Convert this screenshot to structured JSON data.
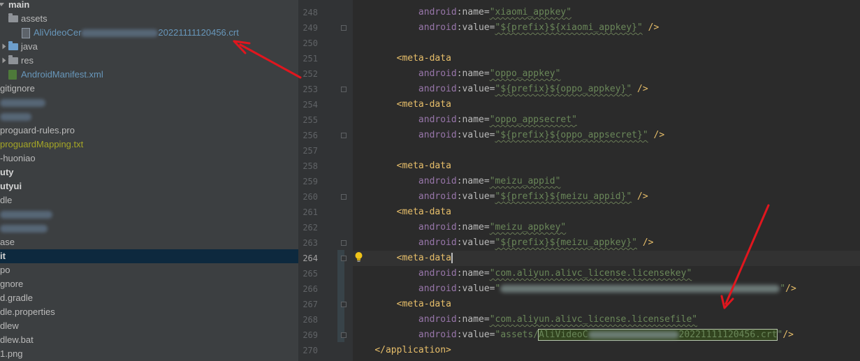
{
  "project_tree": {
    "items": [
      {
        "label": "main",
        "style": "bold"
      },
      {
        "label": "assets",
        "style": "normal"
      },
      {
        "label_prefix": "AliVideoCer",
        "label_suffix": "20221111120456.crt",
        "style": "blue"
      },
      {
        "label": "java",
        "style": "normal"
      },
      {
        "label": "res",
        "style": "normal"
      },
      {
        "label": "AndroidManifest.xml",
        "style": "blue"
      },
      {
        "label": "gitignore",
        "style": "normal"
      },
      {
        "label": "",
        "style": "blurred"
      },
      {
        "label": "",
        "style": "blurred"
      },
      {
        "label": "proguard-rules.pro",
        "style": "normal"
      },
      {
        "label": "proguardMapping.txt",
        "style": "olive"
      },
      {
        "label": "-huoniao",
        "style": "normal"
      },
      {
        "label": "uty",
        "style": "bold"
      },
      {
        "label": "utyui",
        "style": "bold"
      },
      {
        "label": "dle",
        "style": "normal"
      },
      {
        "label": "",
        "style": "blurred"
      },
      {
        "label": "",
        "style": "blurred"
      },
      {
        "label": "ase",
        "style": "normal"
      },
      {
        "label": "it",
        "style": "bold-selected"
      },
      {
        "label": "po",
        "style": "normal"
      },
      {
        "label": "gnore",
        "style": "normal"
      },
      {
        "label": "d.gradle",
        "style": "normal"
      },
      {
        "label": "dle.properties",
        "style": "normal"
      },
      {
        "label": "dlew",
        "style": "normal"
      },
      {
        "label": "dlew.bat",
        "style": "normal"
      },
      {
        "label": "1.png",
        "style": "normal"
      }
    ]
  },
  "editor": {
    "current_line": 264,
    "lines": [
      {
        "n": "248",
        "attr": "name",
        "val": "xiaomi_appkey",
        "end": ""
      },
      {
        "n": "249",
        "attr": "value",
        "val": "${prefix}${xiaomi_appkey}",
        "end": " />"
      },
      {
        "n": "250"
      },
      {
        "n": "251",
        "open": "meta-data"
      },
      {
        "n": "252",
        "attr": "name",
        "val": "oppo_appkey",
        "end": ""
      },
      {
        "n": "253",
        "attr": "value",
        "val": "${prefix}${oppo_appkey}",
        "end": " />"
      },
      {
        "n": "254",
        "open": "meta-data"
      },
      {
        "n": "255",
        "attr": "name",
        "val": "oppo_appsecret",
        "end": ""
      },
      {
        "n": "256",
        "attr": "value",
        "val": "${prefix}${oppo_appsecret}",
        "end": " />"
      },
      {
        "n": "257"
      },
      {
        "n": "258",
        "open": "meta-data"
      },
      {
        "n": "259",
        "attr": "name",
        "val": "meizu_appid",
        "end": ""
      },
      {
        "n": "260",
        "attr": "value",
        "val": "${prefix}${meizu_appid}",
        "end": " />"
      },
      {
        "n": "261",
        "open": "meta-data"
      },
      {
        "n": "262",
        "attr": "name",
        "val": "meizu_appkey",
        "end": ""
      },
      {
        "n": "263",
        "attr": "value",
        "val": "${prefix}${meizu_appkey}",
        "end": " />"
      },
      {
        "n": "264",
        "open": "meta-data",
        "caret": true
      },
      {
        "n": "265",
        "attr": "name",
        "val": "com.aliyun.alivc_license.licensekey",
        "end": ""
      },
      {
        "n": "266",
        "attr": "value",
        "val_blurred": true,
        "end": "/>"
      },
      {
        "n": "267",
        "open": "meta-data"
      },
      {
        "n": "268",
        "attr": "name",
        "val": "com.aliyun.alivc_license.licensefile",
        "end": ""
      },
      {
        "n": "269",
        "attr": "value",
        "val_pre": "assets/",
        "val_hl_prefix": "AliVideoC",
        "val_hl_suffix": "20221111120456.crt",
        "end": "/>"
      },
      {
        "n": "270",
        "close": "application"
      }
    ]
  },
  "syntax": {
    "ns_prefix": "android"
  },
  "colors": {
    "tree_bg": "#3c3f41",
    "editor_bg": "#2b2b2b",
    "gutter_bg": "#313335",
    "tag": "#e8bf6a",
    "namespace": "#9876aa",
    "attr_value": "#6a8759",
    "annotation_arrow": "#e0161e",
    "selected_row": "#0d293e"
  },
  "annotations": [
    {
      "type": "arrow",
      "points_to": "crt file in assets folder"
    },
    {
      "type": "arrow",
      "points_to": "licensefile value"
    }
  ]
}
